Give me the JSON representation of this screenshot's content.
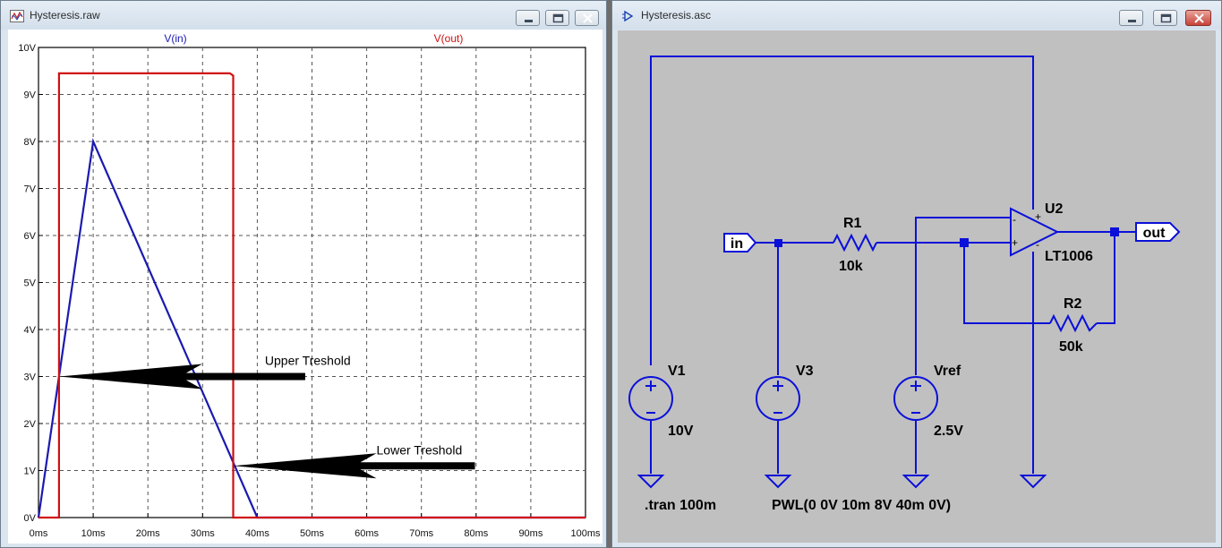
{
  "plot_window": {
    "title": "Hysteresis.raw",
    "traces": [
      {
        "name": "V(in)",
        "color": "#1a1ab0"
      },
      {
        "name": "V(out)",
        "color": "#d01010"
      }
    ],
    "annotations": {
      "upper": "Upper Treshold",
      "lower": "Lower Treshold"
    }
  },
  "chart_data": {
    "type": "line",
    "x": {
      "ticks": [
        "0ms",
        "10ms",
        "20ms",
        "30ms",
        "40ms",
        "50ms",
        "60ms",
        "70ms",
        "80ms",
        "90ms",
        "100ms"
      ],
      "range": [
        0,
        100
      ],
      "unit": "ms"
    },
    "y": {
      "ticks": [
        "0V",
        "1V",
        "2V",
        "3V",
        "4V",
        "5V",
        "6V",
        "7V",
        "8V",
        "9V",
        "10V"
      ],
      "range": [
        0,
        10
      ],
      "unit": "V"
    },
    "grid": true,
    "series": [
      {
        "name": "V(in)",
        "color": "#1a1ab0",
        "points": [
          [
            0,
            0
          ],
          [
            10,
            8
          ],
          [
            40,
            0
          ],
          [
            100,
            0
          ]
        ]
      },
      {
        "name": "V(out)",
        "color": "#d01010",
        "points": [
          [
            0,
            0
          ],
          [
            3.75,
            0
          ],
          [
            3.75,
            9.45
          ],
          [
            35,
            9.45
          ],
          [
            35.6,
            9.4
          ],
          [
            35.6,
            0
          ],
          [
            100,
            0
          ]
        ]
      }
    ],
    "annotations": [
      {
        "text": "Upper Treshold",
        "x": 3.75,
        "y": 3.0
      },
      {
        "text": "Lower Treshold",
        "x": 35.6,
        "y": 1.1
      }
    ]
  },
  "schematic_window": {
    "title": "Hysteresis.asc",
    "labels": {
      "in": "in",
      "out": "out",
      "r1_name": "R1",
      "r1_value": "10k",
      "r2_name": "R2",
      "r2_value": "50k",
      "u2_name": "U2",
      "u2_value": "LT1006",
      "v1_name": "V1",
      "v1_value": "10V",
      "v3_name": "V3",
      "v3_value": "PWL(0 0V 10m 8V 40m 0V)",
      "vref_name": "Vref",
      "vref_value": "2.5V",
      "directive": ".tran 100m",
      "plus": "+",
      "minus": "-"
    }
  }
}
